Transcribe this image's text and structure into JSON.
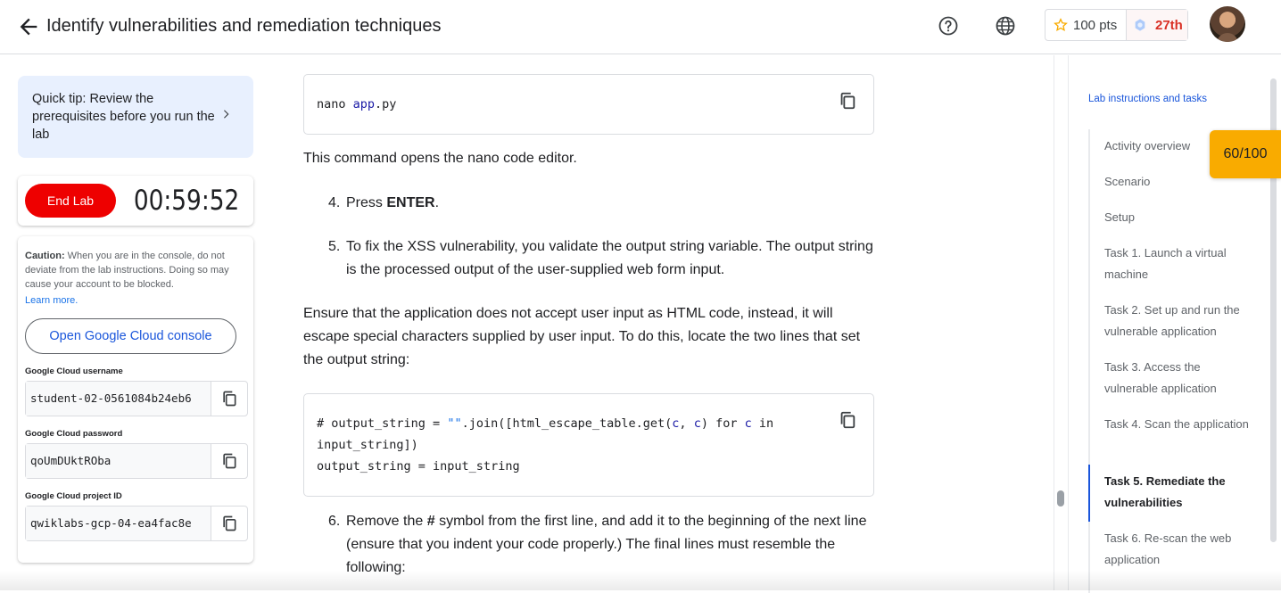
{
  "header": {
    "title": "Identify vulnerabilities and remediation techniques",
    "help_icon": "help-circle-icon",
    "language_icon": "globe-icon",
    "points": "100 pts",
    "rank": "27th",
    "avatar_icon": "user-avatar"
  },
  "left": {
    "tip": "Quick tip: Review the prerequisites before you run the lab",
    "end_lab": "End Lab",
    "timer": "00:59:52",
    "caution_bold": "Caution:",
    "caution_text": " When you are in the console, do not deviate from the lab instructions. Doing so may cause your account to be blocked.",
    "learn_more": "Learn more.",
    "console_button": "Open Google Cloud console",
    "fields": [
      {
        "label": "Google Cloud username",
        "value": "student-02-0561084b24eb6"
      },
      {
        "label": "Google Cloud password",
        "value": "qoUmDUktROba"
      },
      {
        "label": "Google Cloud project ID",
        "value": "qwiklabs-gcp-04-ea4fac8e"
      }
    ]
  },
  "content": {
    "code1": {
      "cmd": "nano ",
      "arg": "app",
      "rest": ".py"
    },
    "p1": "This command opens the nano code editor.",
    "step4_num": "4.",
    "step4_pre": "Press ",
    "step4_bold": "ENTER",
    "step4_post": ".",
    "step5_num": "5.",
    "step5": "To fix the XSS vulnerability, you validate the output string variable. The output string is the processed output of the user-supplied web form input.",
    "p2": "Ensure that the application does not accept user input as HTML code, instead, it will escape special characters supplied by user input. To do this, locate the two lines that set the output string:",
    "code2": {
      "l1a": "# output_string = ",
      "l1b": "\"\"",
      "l1c": ".join([html_escape_table.get(",
      "l1d": "c",
      "l1e": ", ",
      "l1f": "c",
      "l1g": ") for ",
      "l1h": "c",
      "l1i": " in input_string])",
      "l2": "output_string = input_string"
    },
    "step6_num": "6.",
    "step6_pre": "Remove the ",
    "step6_bold": "#",
    "step6_post": " symbol from the first line, and add it to the beginning of the next line (ensure that you indent your code properly.) The final lines must resemble the following:"
  },
  "toc": {
    "title": "Lab instructions and tasks",
    "items": [
      "Activity overview",
      "Scenario",
      "Setup",
      "Task 1. Launch a virtual machine",
      "Task 2. Set up and run the vulnerable application",
      "Task 3. Access the vulnerable application",
      "Task 4. Scan the application",
      "Task 5. Remediate the vulnerabilities",
      "Task 6. Re-scan the web application"
    ],
    "score_badge": "60/100"
  }
}
